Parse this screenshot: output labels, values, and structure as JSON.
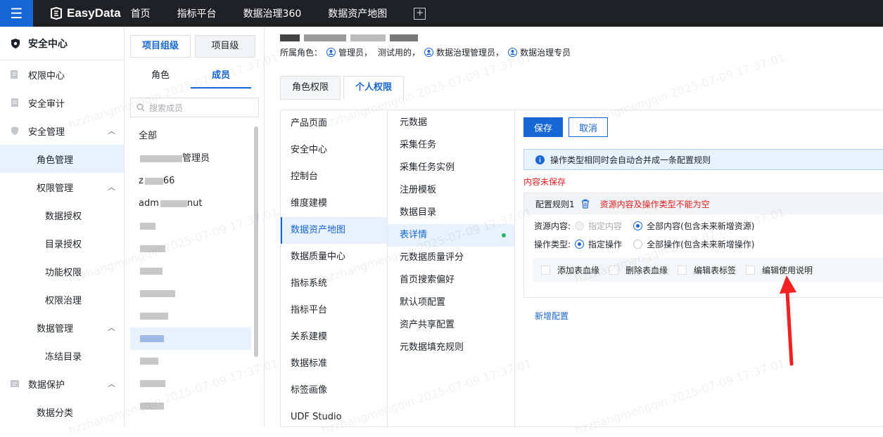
{
  "topbar": {
    "brand": "EasyData",
    "nav": [
      "首页",
      "指标平台",
      "数据治理360",
      "数据资产地图"
    ],
    "add_label": "+"
  },
  "sidebar": {
    "title": "安全中心",
    "items": [
      {
        "label": "权限中心",
        "level": 1,
        "icon": "doc-edit-icon"
      },
      {
        "label": "安全审计",
        "level": 1,
        "icon": "audit-icon"
      },
      {
        "label": "安全管理",
        "level": 1,
        "icon": "shield-icon",
        "expanded": true
      },
      {
        "label": "角色管理",
        "level": 2,
        "active": true
      },
      {
        "label": "权限管理",
        "level": 2,
        "expanded": true
      },
      {
        "label": "数据授权",
        "level": 3
      },
      {
        "label": "目录授权",
        "level": 3
      },
      {
        "label": "功能权限",
        "level": 3
      },
      {
        "label": "权限治理",
        "level": 3
      },
      {
        "label": "数据管理",
        "level": 2,
        "expanded": true
      },
      {
        "label": "冻结目录",
        "level": 3
      },
      {
        "label": "数据保护",
        "level": 1,
        "icon": "protect-icon",
        "expanded": true
      },
      {
        "label": "数据分类",
        "level": 2
      }
    ]
  },
  "members": {
    "seg_group": "项目组级",
    "seg_project": "项目级",
    "tab_role": "角色",
    "tab_member": "成员",
    "search_placeholder": "搜索成员",
    "list": [
      "全部",
      "",
      "z",
      "adm",
      "",
      "",
      "",
      "",
      "",
      "",
      "",
      "",
      ""
    ],
    "list_suffix": [
      "",
      "管理员",
      "66",
      "nut",
      "",
      "",
      "",
      "",
      "",
      "",
      "",
      "",
      ""
    ]
  },
  "main": {
    "roles_prefix": "所属角色：",
    "roles": [
      "管理员，",
      "测试用的，",
      "数据治理管理员，",
      "数据治理专员"
    ],
    "tab_role_perm": "角色权限",
    "tab_personal_perm": "个人权限",
    "modules": [
      "产品页面",
      "安全中心",
      "控制台",
      "维度建模",
      "数据资产地图",
      "数据质量中心",
      "指标系统",
      "指标平台",
      "关系建模",
      "数据标准",
      "标签画像",
      "UDF Studio"
    ],
    "selected_module": "数据资产地图",
    "features": [
      "元数据",
      "采集任务",
      "采集任务实例",
      "注册模板",
      "数据目录",
      "表详情",
      "元数据质量评分",
      "首页搜索偏好",
      "默认项配置",
      "资产共享配置",
      "元数据填充规则"
    ],
    "selected_feature": "表详情",
    "save": "保存",
    "cancel": "取消",
    "notice": "操作类型相同时会自动合并成一条配置规则",
    "unsaved": "内容未保存",
    "rule_title": "配置规则1",
    "rule_error": "资源内容及操作类型不能为空",
    "resource_label": "资源内容:",
    "resource_opt1": "指定内容",
    "resource_opt2": "全部内容(包含未来新增资源)",
    "op_label": "操作类型:",
    "op_opt1": "指定操作",
    "op_opt2": "全部操作(包含未来新增操作)",
    "checks": [
      "添加表血缘",
      "删除表血缘",
      "编辑表标签",
      "编辑使用说明"
    ],
    "add_config": "新增配置"
  },
  "watermark": "hzzhangmengqin 2025-07-09 17:37:01",
  "colors": {
    "accent": "#1766d6",
    "error": "#e02020",
    "topbar": "#1f2126"
  }
}
